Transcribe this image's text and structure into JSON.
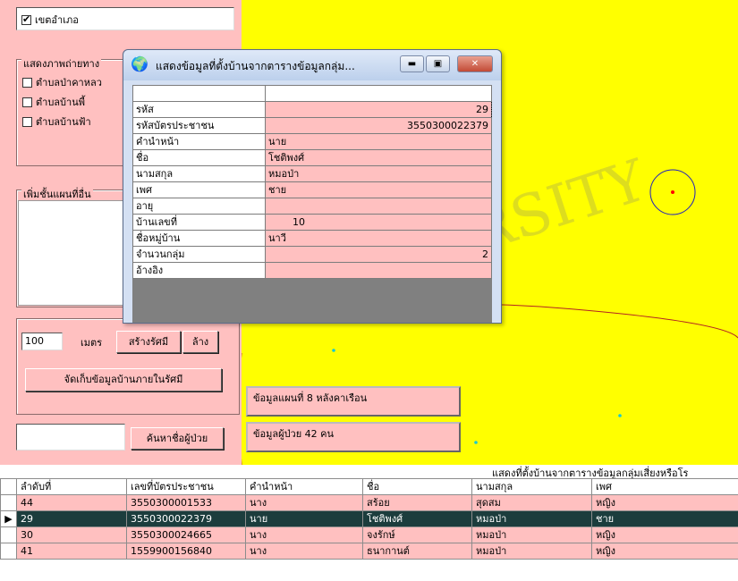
{
  "left_panel": {
    "district_checkbox": {
      "label": "เขตอำเภอ",
      "checked": true
    },
    "photo_group": {
      "title": "แสดงภาพถ่ายทาง",
      "items": [
        {
          "label": "ตำบลป่าคาหลว",
          "checked": false
        },
        {
          "label": "ตำบลบ้านพี้",
          "checked": false
        },
        {
          "label": "ตำบลบ้านฟ้า",
          "checked": false
        }
      ]
    },
    "layer_group": {
      "title": "เพิ่มชั้นแผนที่อื่น"
    },
    "radius": {
      "value": "100",
      "unit": "เมตร",
      "create_label": "สร้างรัศมี",
      "clear_label": "ล้าง"
    },
    "store_button": "จัดเก็บข้อมูลบ้านภายในรัศมี",
    "search": {
      "value": "",
      "button": "ค้นหาชื่อผู้ป่วย"
    }
  },
  "map": {
    "info_houses": "ข้อมูลแผนที่ 8 หลังคาเรือน",
    "info_patients": "ข้อมูลผู้ป่วย 42 คน",
    "colors": {
      "background": "#ffff00",
      "circle": "#1f1fbf",
      "marker": "#ff0000",
      "boundary": "#b22222"
    }
  },
  "dialog": {
    "title": "แสดงข้อมูลที่ตั้งบ้านจากตารางข้อมูลกลุ่ม...",
    "rows": [
      {
        "key": "รหัส",
        "value": "29",
        "align": "right"
      },
      {
        "key": "รหัสบัตรประชาชน",
        "value": "3550300022379",
        "align": "right"
      },
      {
        "key": "คำนำหน้า",
        "value": "นาย",
        "align": "left"
      },
      {
        "key": "ชื่อ",
        "value": "โชติพงศ์",
        "align": "left"
      },
      {
        "key": "นามสกุล",
        "value": "หมอป่า",
        "align": "left"
      },
      {
        "key": "เพศ",
        "value": "ชาย",
        "align": "left"
      },
      {
        "key": "อายุ",
        "value": "",
        "align": "left"
      },
      {
        "key": "บ้านเลขที่",
        "value": "10",
        "align": "center"
      },
      {
        "key": "ชื่อหมู่บ้าน",
        "value": "นาวี",
        "align": "left"
      },
      {
        "key": "จำนวนกลุ่ม",
        "value": "2",
        "align": "right"
      },
      {
        "key": "อ้างอิง",
        "value": "",
        "align": "left"
      }
    ]
  },
  "table": {
    "caption": "แสดงที่ตั้งบ้านจากตารางข้อมูลกลุ่มเสี่ยงหรือโร",
    "columns": [
      "ลำดับที่",
      "เลขที่บัตรประชาชน",
      "คำนำหน้า",
      "ชื่อ",
      "นามสกุล",
      "เพศ"
    ],
    "rows": [
      [
        "44",
        "3550300001533",
        "นาง",
        "สร้อย",
        "สุดสม",
        "หญิง"
      ],
      [
        "29",
        "3550300022379",
        "นาย",
        "โชติพงศ์",
        "หมอป่า",
        "ชาย"
      ],
      [
        "30",
        "3550300024665",
        "นาง",
        "จงรักษ์",
        "หมอป่า",
        "หญิง"
      ],
      [
        "41",
        "1559900156840",
        "นาง",
        "ธนากานต์",
        "หมอป่า",
        "หญิง"
      ]
    ],
    "selected_row": 1
  }
}
